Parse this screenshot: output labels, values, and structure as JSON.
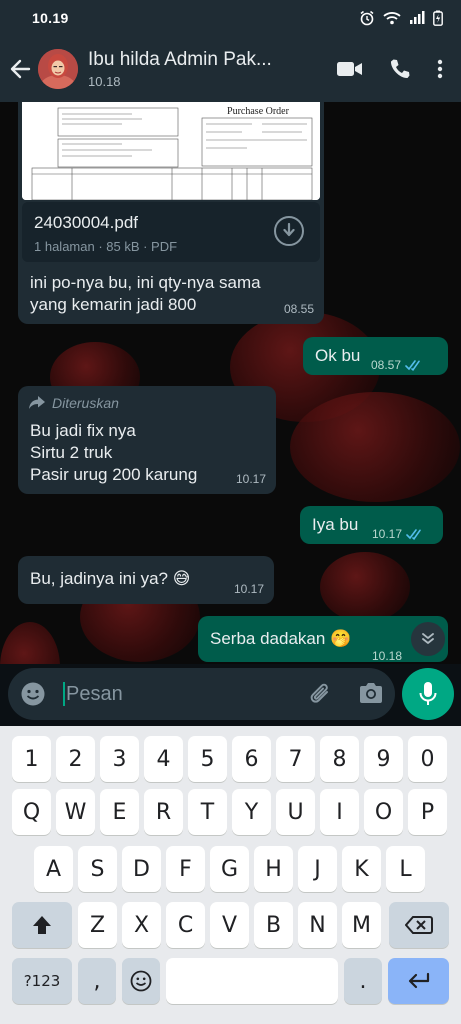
{
  "status_bar": {
    "time": "10.19"
  },
  "header": {
    "contact_name": "Ibu hilda Admin Pak...",
    "last_seen": "10.18"
  },
  "messages": {
    "doc": {
      "preview_title": "Purchase Order",
      "file_name": "24030004.pdf",
      "file_info": "1 halaman · 85 kB · PDF",
      "caption": "ini po-nya bu, ini qty-nya sama yang kemarin jadi 800",
      "time": "08.55"
    },
    "ok": {
      "text": "Ok bu",
      "time": "08.57"
    },
    "forwarded": {
      "label": "Diteruskan",
      "line1": "Bu jadi fix nya",
      "line2": "Sirtu 2 truk",
      "line3": "Pasir urug 200 karung",
      "time": "10.17"
    },
    "iya": {
      "text": "Iya bu",
      "time": "10.17"
    },
    "jadinya": {
      "text": "Bu, jadinya ini ya?",
      "emoji": "😅",
      "time": "10.17"
    },
    "dadakan": {
      "text": "Serba dadakan",
      "emoji": "🤭",
      "time": "10.18"
    }
  },
  "composer": {
    "placeholder": "Pesan"
  },
  "keyboard": {
    "row1": [
      "1",
      "2",
      "3",
      "4",
      "5",
      "6",
      "7",
      "8",
      "9",
      "0"
    ],
    "row2": [
      "Q",
      "W",
      "E",
      "R",
      "T",
      "Y",
      "U",
      "I",
      "O",
      "P"
    ],
    "row3": [
      "A",
      "S",
      "D",
      "F",
      "G",
      "H",
      "J",
      "K",
      "L"
    ],
    "row4": [
      "Z",
      "X",
      "C",
      "V",
      "B",
      "N",
      "M"
    ],
    "symbols_label": "?123",
    "comma": ",",
    "period": "."
  },
  "colors": {
    "header_bg": "#1f2c34",
    "incoming_bubble": "#1f2c34",
    "outgoing_bubble": "#005c4b",
    "accent": "#00a884",
    "read_ticks": "#53bdeb"
  }
}
